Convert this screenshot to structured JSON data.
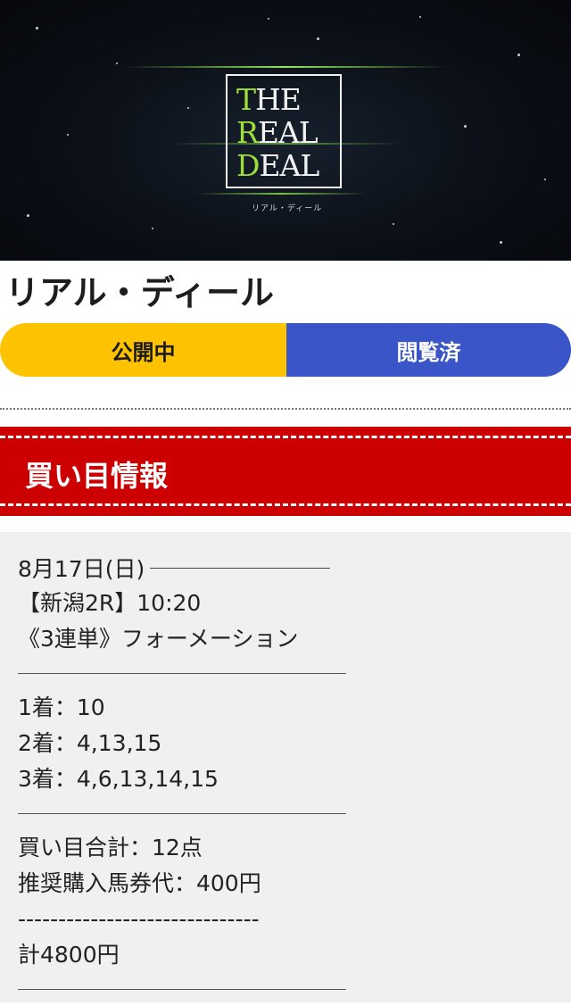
{
  "banner_logo": {
    "line1": "THE",
    "line2": "REAL",
    "line3": "DEAL",
    "subtitle": "リアル・ディール"
  },
  "page_title": "リアル・ディール",
  "status": {
    "open_label": "公開中",
    "viewed_label": "閲覧済",
    "open_color": "#fdc200",
    "viewed_color": "#3a55c8"
  },
  "section": {
    "heading": "買い目情報",
    "color": "#cc0000"
  },
  "race": {
    "date": "8月17日(日)",
    "venue_time": "【新潟2R】10:20",
    "bet_type": "《3連単》フォーメーション"
  },
  "picks": {
    "first": "1着：10",
    "second": "2着：4,13,15",
    "third": "3着：4,6,13,14,15"
  },
  "summary": {
    "total_points": "買い目合計：12点",
    "recommended": "推奨購入馬券代：400円",
    "divider": "------------------------------",
    "total": "計4800円"
  }
}
